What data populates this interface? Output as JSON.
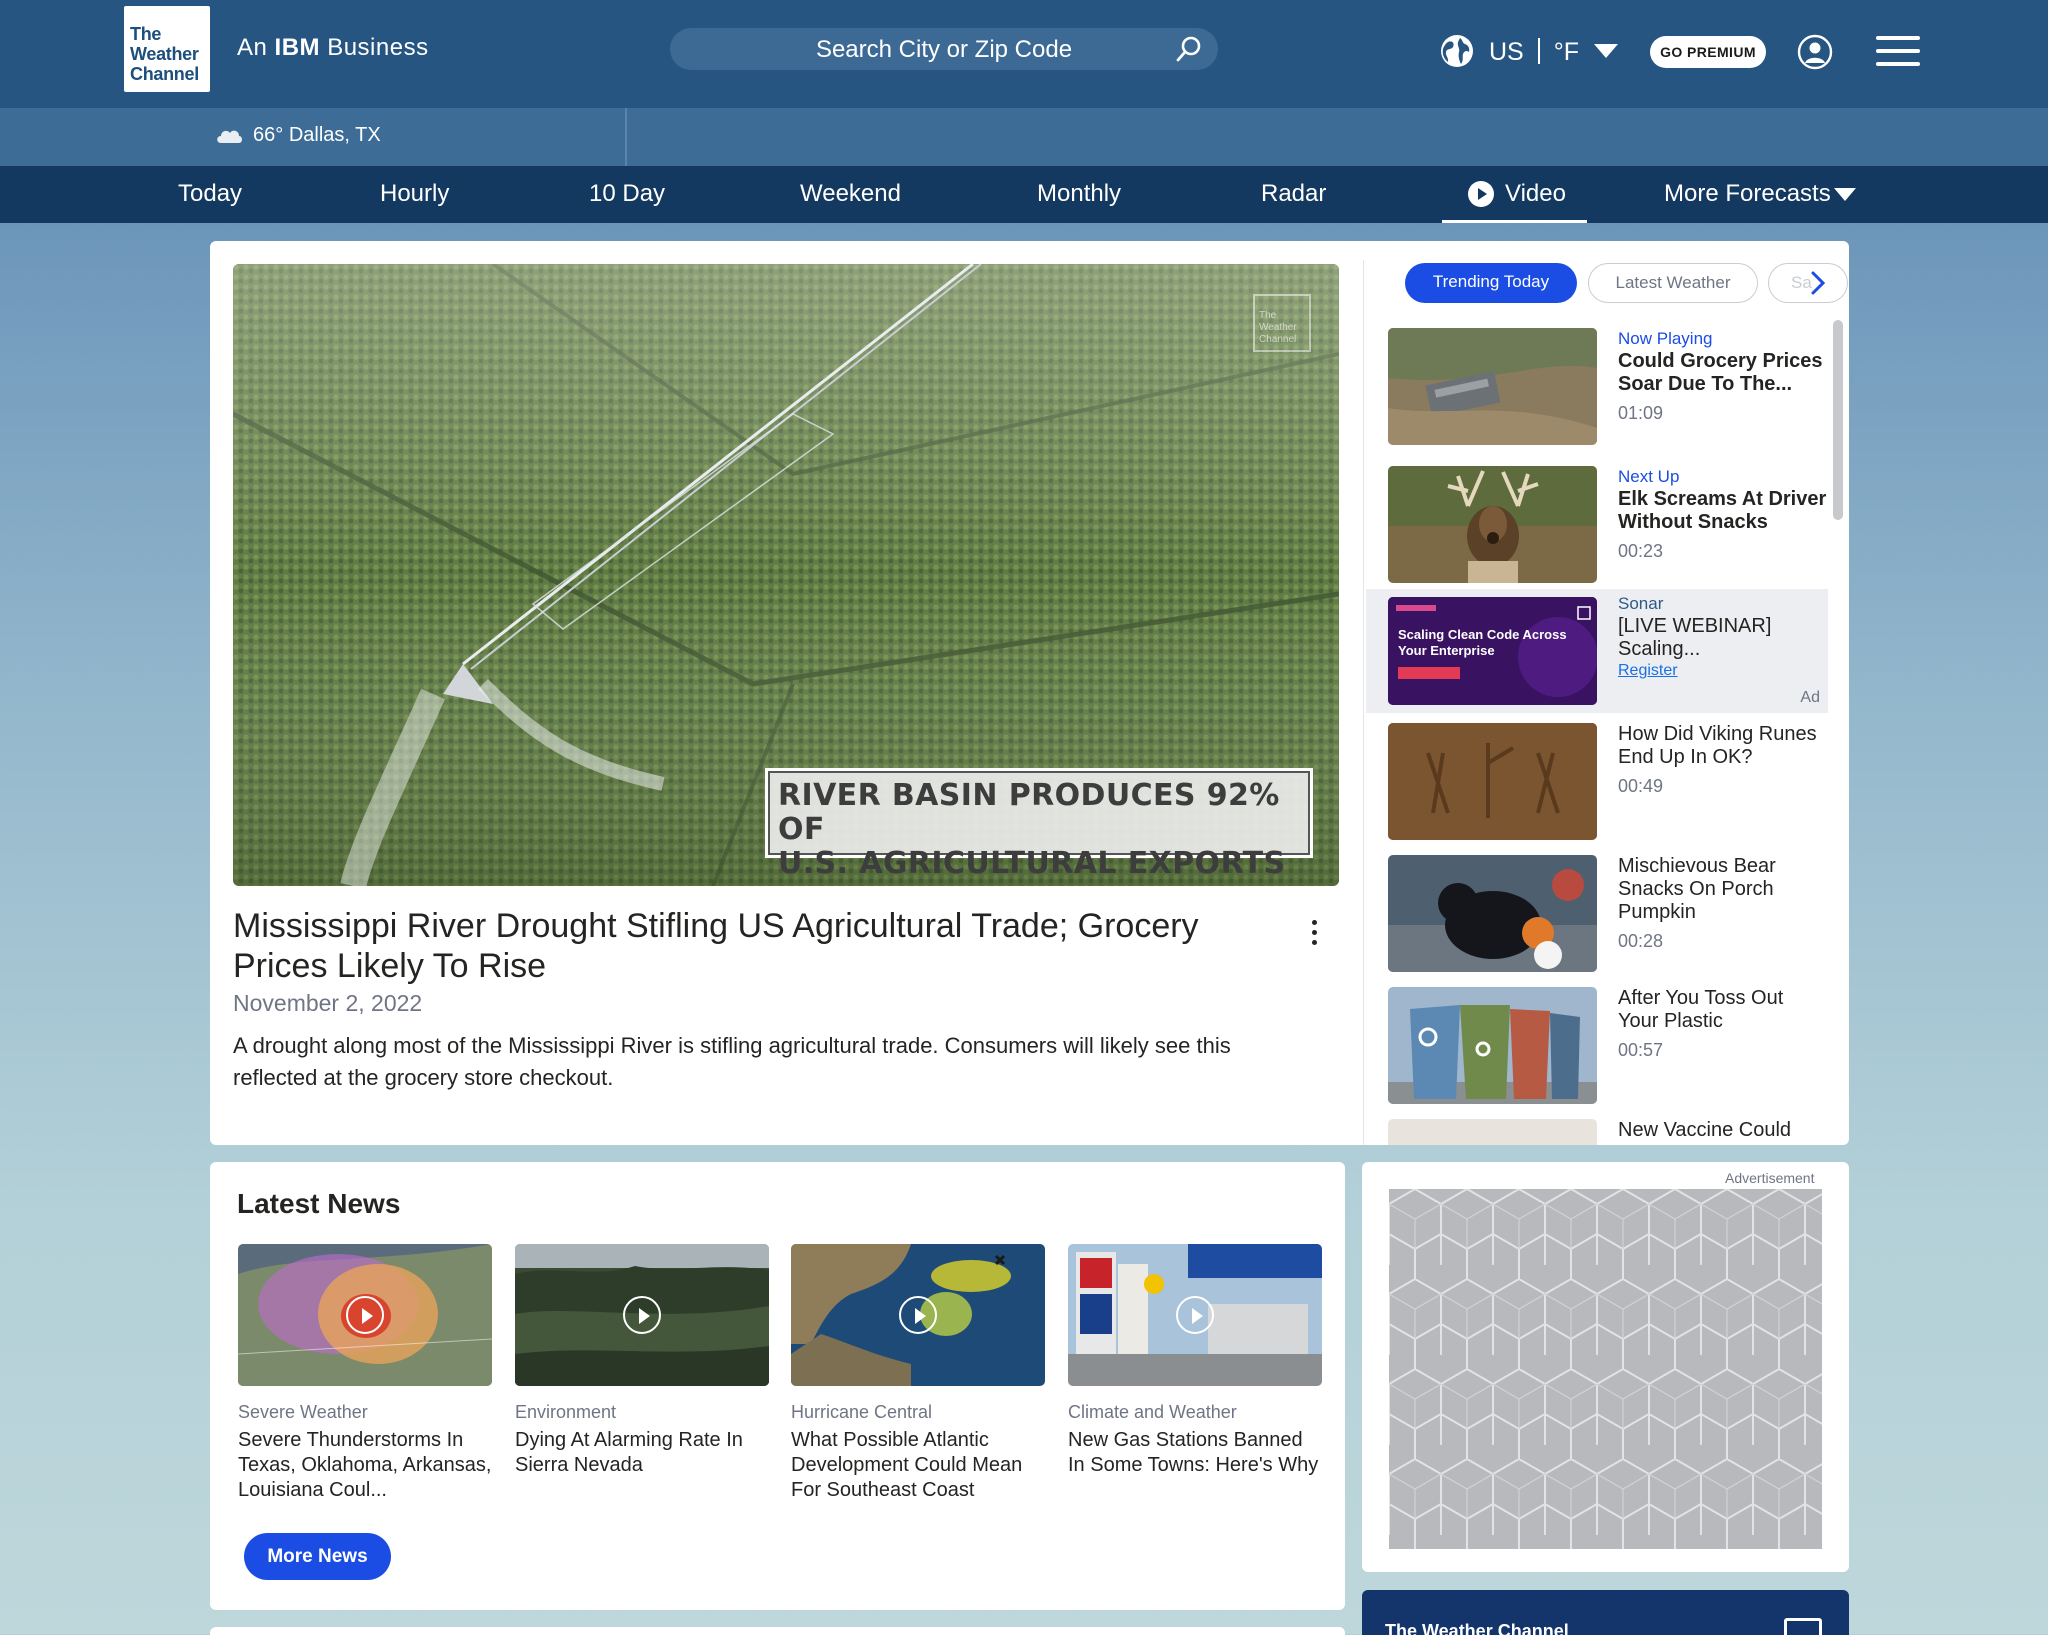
{
  "header": {
    "logo_lines": [
      "The",
      "Weather",
      "Channel"
    ],
    "tagline_prefix": "An",
    "tagline_brand": "IBM",
    "tagline_suffix": "Business",
    "search_placeholder": "Search City or Zip Code",
    "region": "US",
    "unit": "°F",
    "premium_label": "GO PREMIUM"
  },
  "location": {
    "temperature": "66°",
    "city": "Dallas, TX"
  },
  "nav": {
    "items": [
      "Today",
      "Hourly",
      "10 Day",
      "Weekend",
      "Monthly",
      "Radar",
      "Video",
      "More Forecasts"
    ],
    "active": "Video"
  },
  "video": {
    "watermark": "The Weather Channel",
    "lower_third": [
      "RIVER BASIN PRODUCES 92% OF",
      "U.S. AGRICULTURAL EXPORTS"
    ],
    "title": "Mississippi River Drought Stifling US Agricultural Trade; Grocery Prices Likely To Rise",
    "date": "November 2, 2022",
    "description": "A drought along most of the Mississippi River is stifling agricultural trade. Consumers will likely see this reflected at the grocery store checkout."
  },
  "playlist": {
    "tabs": [
      "Trending Today",
      "Latest Weather",
      "Sa"
    ],
    "items": [
      {
        "label": "Now Playing",
        "title": "Could Grocery Prices Soar Due To The...",
        "duration": "01:09"
      },
      {
        "label": "Next Up",
        "title": "Elk Screams At Driver Without Snacks",
        "duration": "00:23"
      },
      {
        "sponsor": "Sonar",
        "title": "[LIVE WEBINAR] Scaling...",
        "cta": "Register",
        "ad_label": "Ad",
        "thumb_text": "Scaling Clean Code Across Your Enterprise"
      },
      {
        "title": "How Did Viking Runes End Up In OK?",
        "duration": "00:49"
      },
      {
        "title": "Mischievous Bear Snacks On Porch Pumpkin",
        "duration": "00:28"
      },
      {
        "title": "After You Toss Out Your Plastic",
        "duration": "00:57"
      },
      {
        "title": "New Vaccine Could Prevent"
      }
    ]
  },
  "news": {
    "heading": "Latest News",
    "items": [
      {
        "category": "Severe Weather",
        "title": "Severe Thunderstorms In Texas, Oklahoma, Arkansas, Louisiana Coul..."
      },
      {
        "category": "Environment",
        "title": "Dying At Alarming Rate In Sierra Nevada"
      },
      {
        "category": "Hurricane Central",
        "title": "What Possible Atlantic Development Could Mean For Southeast Coast"
      },
      {
        "category": "Climate and Weather",
        "title": "New Gas Stations Banned In Some Towns: Here's Why"
      }
    ],
    "more_label": "More News"
  },
  "ad": {
    "label": "Advertisement"
  },
  "footer_card": {
    "title": "The Weather Channel"
  },
  "colors": {
    "header": "#265582",
    "nav": "#143960",
    "accent": "#1b4de4"
  }
}
